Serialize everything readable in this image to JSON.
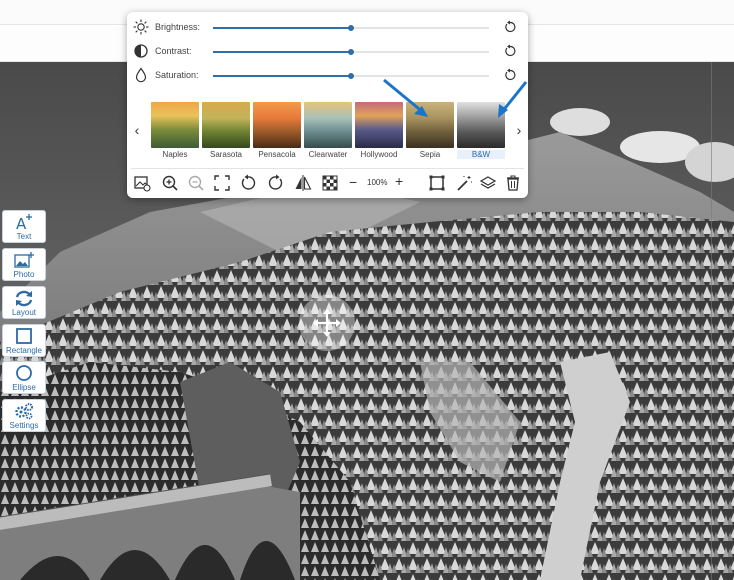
{
  "adjustments": [
    {
      "key": "brightness",
      "label": "Brightness:",
      "icon": "sun-icon",
      "value": 0.5
    },
    {
      "key": "contrast",
      "label": "Contrast:",
      "icon": "contrast-icon",
      "value": 0.5
    },
    {
      "key": "saturation",
      "label": "Saturation:",
      "icon": "droplet-icon",
      "value": 0.5
    }
  ],
  "filters": [
    {
      "name": "Naples",
      "selected": false
    },
    {
      "name": "Sarasota",
      "selected": false
    },
    {
      "name": "Pensacola",
      "selected": false
    },
    {
      "name": "Clearwater",
      "selected": false
    },
    {
      "name": "Hollywood",
      "selected": false
    },
    {
      "name": "Sepia",
      "selected": false
    },
    {
      "name": "B&W",
      "selected": true
    }
  ],
  "toolbar": {
    "zoom_value": "100%",
    "zoom_minus": "−",
    "zoom_plus": "+"
  },
  "tools": [
    {
      "label": "Text",
      "icon": "text-add-icon"
    },
    {
      "label": "Photo",
      "icon": "photo-add-icon"
    },
    {
      "label": "Layout",
      "icon": "layout-refresh-icon"
    },
    {
      "label": "Rectangle",
      "icon": "rectangle-icon"
    },
    {
      "label": "Ellipse",
      "icon": "ellipse-icon"
    },
    {
      "label": "Settings",
      "icon": "settings-gears-icon"
    }
  ],
  "nav": {
    "prev": "‹",
    "next": "›"
  },
  "colors": {
    "accent": "#2e6ea9",
    "annotation_arrow": "#1a75c9"
  }
}
